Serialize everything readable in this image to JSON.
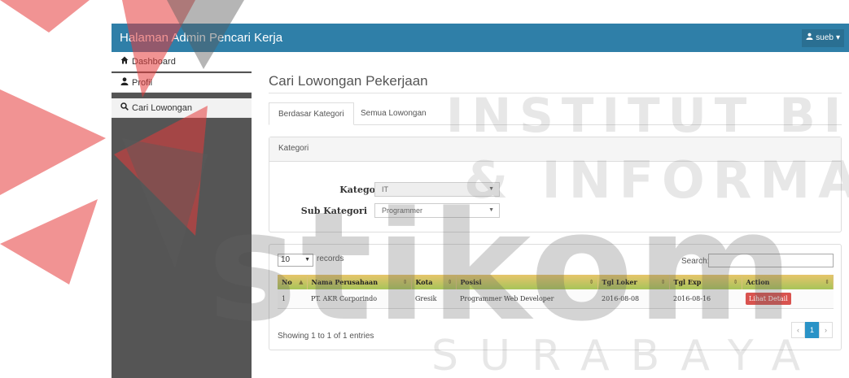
{
  "header": {
    "brand": "Halaman Admin Pencari Kerja",
    "user": "sueb",
    "user_caret": "▾"
  },
  "sidebar": {
    "items": [
      {
        "label": "Dashboard",
        "icon": "⌂"
      },
      {
        "label": "Profil",
        "icon": "👤"
      },
      {
        "label": "Cari Lowongan",
        "icon": "🔍"
      }
    ]
  },
  "page": {
    "title": "Cari Lowongan Pekerjaan"
  },
  "tabs": [
    "Berdasar Kategori",
    "Semua Lowongan"
  ],
  "filter": {
    "panel_title": "Kategori",
    "kategori_label": "Kategori",
    "kategori_value": "IT",
    "sub_kategori_label": "Sub Kategori",
    "sub_kategori_value": "Programmer"
  },
  "table": {
    "length_value": "10",
    "records_label": "records",
    "search_label": "Search:",
    "columns": [
      "No",
      "Nama Perusahaan",
      "Kota",
      "Posisi",
      "Tgl Loker",
      "Tgl Exp",
      "Action"
    ],
    "rows": [
      {
        "no": "1",
        "company": "PT. AKR Corporindo",
        "city": "Gresik",
        "position": "Programmer Web Developer",
        "tgl_loker": "2016-08-08",
        "tgl_exp": "2016-08-16",
        "action": "Lihat Detail"
      }
    ],
    "info": "Showing 1 to 1 of 1 entries",
    "pagination": {
      "prev": "‹",
      "current": "1",
      "next": "›"
    }
  },
  "watermark": {
    "line1": "INSTITUT BISNIS",
    "line2": "& INFORMATIKA",
    "line3": "stikom",
    "line4": "SURABAYA"
  },
  "colors": {
    "topbar": "#2f7fa8",
    "sidebar": "#555555",
    "action_button": "#d9534f",
    "pager_active": "#2a93c7",
    "logo_red": "#e63b3b"
  }
}
